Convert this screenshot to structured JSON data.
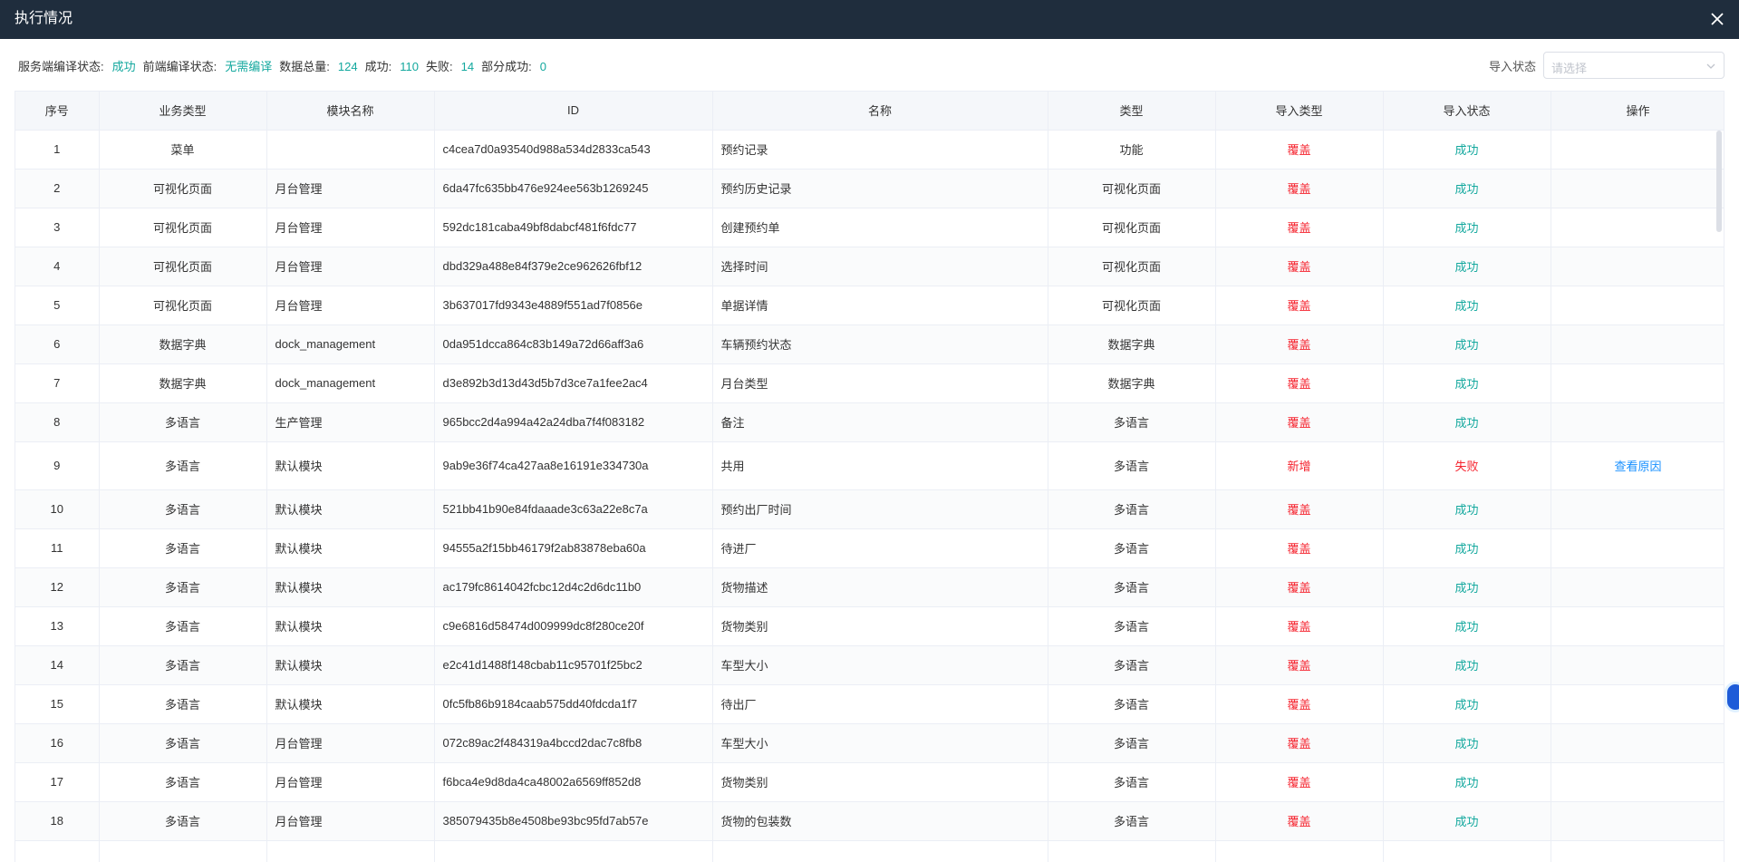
{
  "dialog": {
    "title": "执行情况",
    "close_icon": "close-icon"
  },
  "summary": {
    "server_compile_label": "服务端编译状态:",
    "server_compile_value": "成功",
    "front_compile_label": "前端编译状态:",
    "front_compile_value": "无需编译",
    "total_label": "数据总量:",
    "total_value": "124",
    "success_label": "成功:",
    "success_value": "110",
    "fail_label": "失败:",
    "fail_value": "14",
    "partial_label": "部分成功:",
    "partial_value": "0"
  },
  "filter": {
    "label": "导入状态",
    "placeholder": "请选择"
  },
  "table": {
    "columns": [
      "序号",
      "业务类型",
      "模块名称",
      "ID",
      "名称",
      "类型",
      "导入类型",
      "导入状态",
      "操作"
    ],
    "rows": [
      {
        "no": "1",
        "biz": "菜单",
        "module": "",
        "id": "c4cea7d0a93540d988a534d2833ca543",
        "name": "预约记录",
        "type": "功能",
        "import_type": "覆盖",
        "status": "成功",
        "action": ""
      },
      {
        "no": "2",
        "biz": "可视化页面",
        "module": "月台管理",
        "id": "6da47fc635bb476e924ee563b1269245",
        "name": "预约历史记录",
        "type": "可视化页面",
        "import_type": "覆盖",
        "status": "成功",
        "action": ""
      },
      {
        "no": "3",
        "biz": "可视化页面",
        "module": "月台管理",
        "id": "592dc181caba49bf8dabcf481f6fdc77",
        "name": "创建预约单",
        "type": "可视化页面",
        "import_type": "覆盖",
        "status": "成功",
        "action": ""
      },
      {
        "no": "4",
        "biz": "可视化页面",
        "module": "月台管理",
        "id": "dbd329a488e84f379e2ce962626fbf12",
        "name": "选择时间",
        "type": "可视化页面",
        "import_type": "覆盖",
        "status": "成功",
        "action": ""
      },
      {
        "no": "5",
        "biz": "可视化页面",
        "module": "月台管理",
        "id": "3b637017fd9343e4889f551ad7f0856e",
        "name": "单据详情",
        "type": "可视化页面",
        "import_type": "覆盖",
        "status": "成功",
        "action": ""
      },
      {
        "no": "6",
        "biz": "数据字典",
        "module": "dock_management",
        "id": "0da951dcca864c83b149a72d66aff3a6",
        "name": "车辆预约状态",
        "type": "数据字典",
        "import_type": "覆盖",
        "status": "成功",
        "action": ""
      },
      {
        "no": "7",
        "biz": "数据字典",
        "module": "dock_management",
        "id": "d3e892b3d13d43d5b7d3ce7a1fee2ac4",
        "name": "月台类型",
        "type": "数据字典",
        "import_type": "覆盖",
        "status": "成功",
        "action": ""
      },
      {
        "no": "8",
        "biz": "多语言",
        "module": "生产管理",
        "id": "965bcc2d4a994a42a24dba7f4f083182",
        "name": "备注",
        "type": "多语言",
        "import_type": "覆盖",
        "status": "成功",
        "action": ""
      },
      {
        "no": "9",
        "biz": "多语言",
        "module": "默认模块",
        "id": "9ab9e36f74ca427aa8e16191e334730a",
        "name": "共用",
        "type": "多语言",
        "import_type": "新增",
        "status": "失败",
        "action": "查看原因"
      },
      {
        "no": "10",
        "biz": "多语言",
        "module": "默认模块",
        "id": "521bb41b90e84fdaaade3c63a22e8c7a",
        "name": "预约出厂时间",
        "type": "多语言",
        "import_type": "覆盖",
        "status": "成功",
        "action": ""
      },
      {
        "no": "11",
        "biz": "多语言",
        "module": "默认模块",
        "id": "94555a2f15bb46179f2ab83878eba60a",
        "name": "待进厂",
        "type": "多语言",
        "import_type": "覆盖",
        "status": "成功",
        "action": ""
      },
      {
        "no": "12",
        "biz": "多语言",
        "module": "默认模块",
        "id": "ac179fc8614042fcbc12d4c2d6dc11b0",
        "name": "货物描述",
        "type": "多语言",
        "import_type": "覆盖",
        "status": "成功",
        "action": ""
      },
      {
        "no": "13",
        "biz": "多语言",
        "module": "默认模块",
        "id": "c9e6816d58474d009999dc8f280ce20f",
        "name": "货物类别",
        "type": "多语言",
        "import_type": "覆盖",
        "status": "成功",
        "action": ""
      },
      {
        "no": "14",
        "biz": "多语言",
        "module": "默认模块",
        "id": "e2c41d1488f148cbab11c95701f25bc2",
        "name": "车型大小",
        "type": "多语言",
        "import_type": "覆盖",
        "status": "成功",
        "action": ""
      },
      {
        "no": "15",
        "biz": "多语言",
        "module": "默认模块",
        "id": "0fc5fb86b9184caab575dd40fdcda1f7",
        "name": "待出厂",
        "type": "多语言",
        "import_type": "覆盖",
        "status": "成功",
        "action": ""
      },
      {
        "no": "16",
        "biz": "多语言",
        "module": "月台管理",
        "id": "072c89ac2f484319a4bccd2dac7c8fb8",
        "name": "车型大小",
        "type": "多语言",
        "import_type": "覆盖",
        "status": "成功",
        "action": ""
      },
      {
        "no": "17",
        "biz": "多语言",
        "module": "月台管理",
        "id": "f6bca4e9d8da4ca48002a6569ff852d8",
        "name": "货物类别",
        "type": "多语言",
        "import_type": "覆盖",
        "status": "成功",
        "action": ""
      },
      {
        "no": "18",
        "biz": "多语言",
        "module": "月台管理",
        "id": "385079435b8e4508be93bc95fd7ab57e",
        "name": "货物的包装数",
        "type": "多语言",
        "import_type": "覆盖",
        "status": "成功",
        "action": ""
      },
      {
        "no": "",
        "biz": "",
        "module": "",
        "id": "",
        "name": "",
        "type": "",
        "import_type": "",
        "status": "",
        "action": ""
      }
    ]
  },
  "colors": {
    "header_bg": "#1f2d3d",
    "success": "#13a89e",
    "danger": "#f5222d",
    "link": "#1890ff"
  }
}
